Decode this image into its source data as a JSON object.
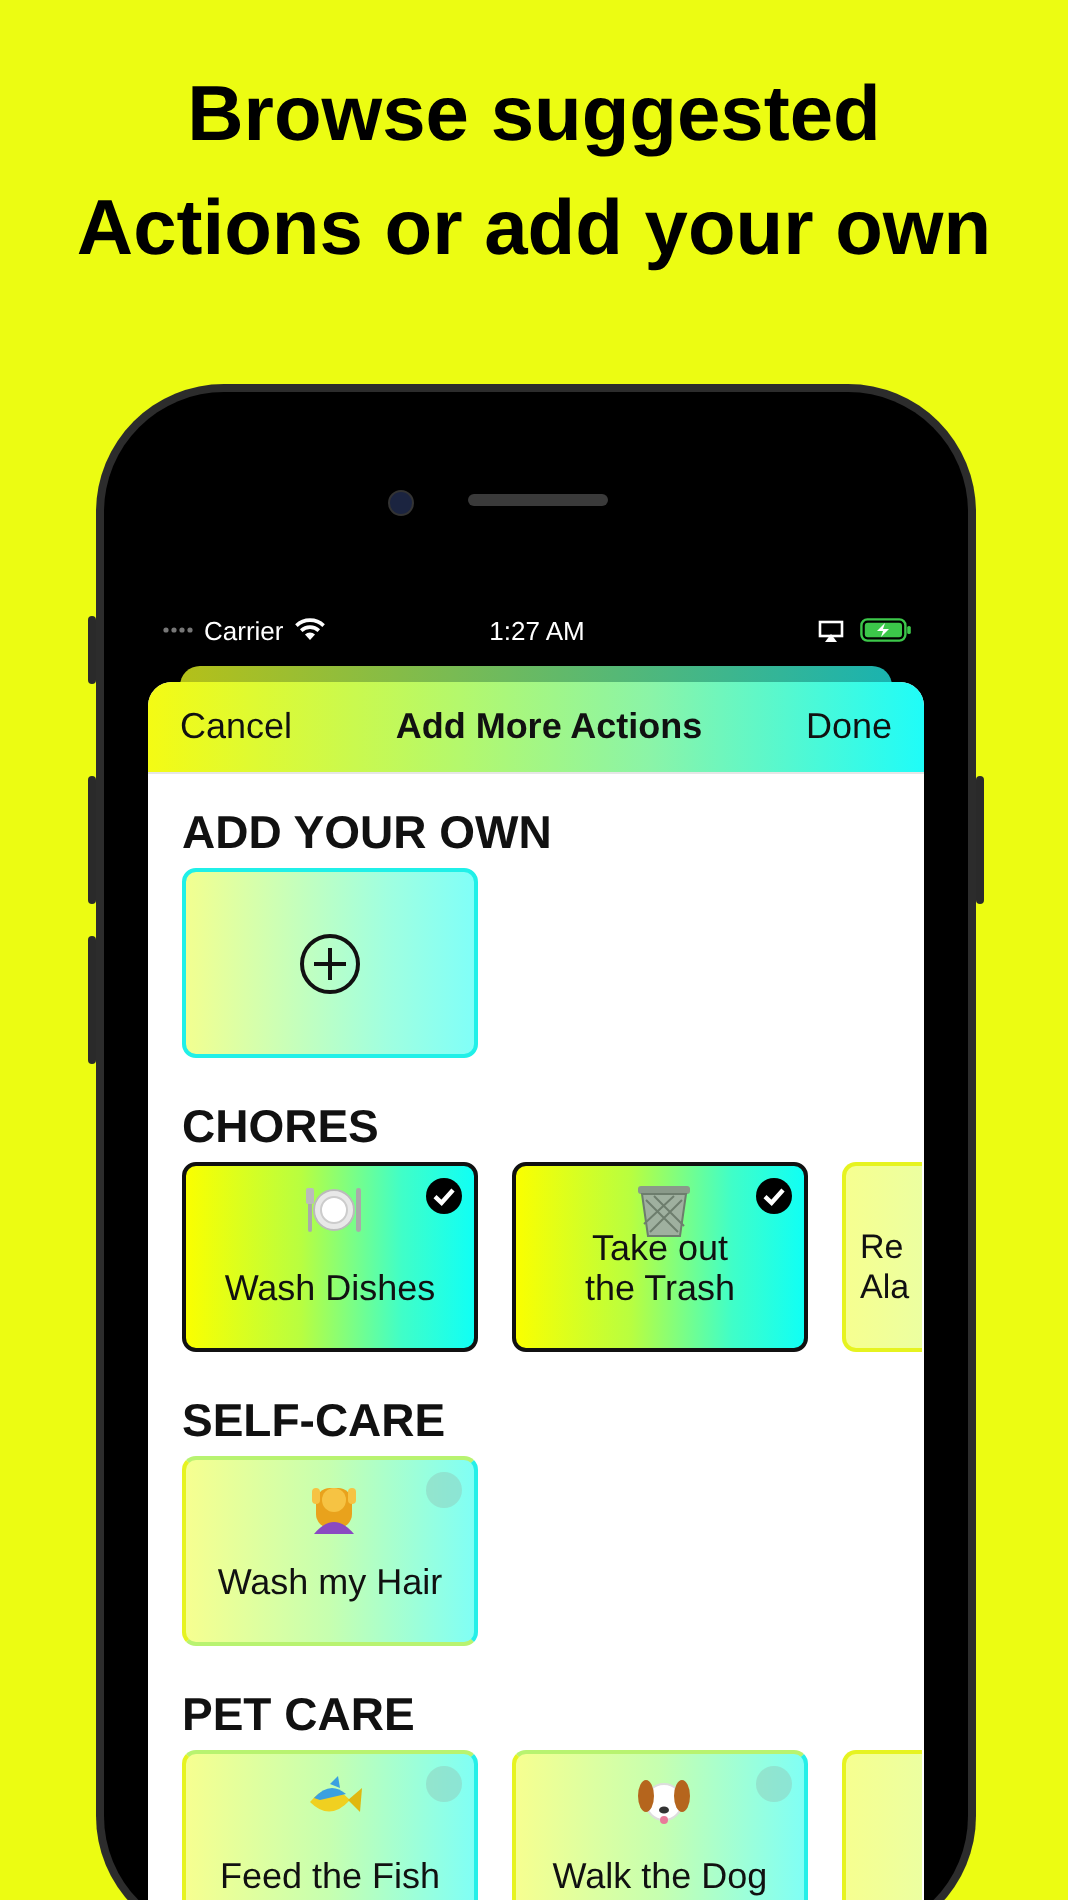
{
  "headline": [
    "Browse suggested",
    "Actions or add your own"
  ],
  "status_bar": {
    "carrier": "Carrier",
    "time": "1:27 AM"
  },
  "sheet": {
    "cancel": "Cancel",
    "title": "Add More Actions",
    "done": "Done"
  },
  "sections": [
    {
      "title": "ADD YOUR OWN",
      "cards": [
        {
          "kind": "add"
        }
      ]
    },
    {
      "title": "CHORES",
      "cards": [
        {
          "kind": "action",
          "lines": [
            "Wash Dishes"
          ],
          "selected": true
        },
        {
          "kind": "action",
          "lines": [
            "Take out",
            "the Trash"
          ],
          "selected": true
        },
        {
          "kind": "partial",
          "lines": [
            "Re",
            "Ala"
          ]
        }
      ]
    },
    {
      "title": "SELF-CARE",
      "cards": [
        {
          "kind": "action",
          "lines": [
            "Wash my Hair"
          ],
          "selected": false
        }
      ]
    },
    {
      "title": "PET CARE",
      "cards": [
        {
          "kind": "action",
          "lines": [
            "Feed the Fish"
          ],
          "selected": false
        },
        {
          "kind": "action",
          "lines": [
            "Walk the Dog"
          ],
          "selected": false
        },
        {
          "kind": "partial"
        }
      ]
    }
  ]
}
